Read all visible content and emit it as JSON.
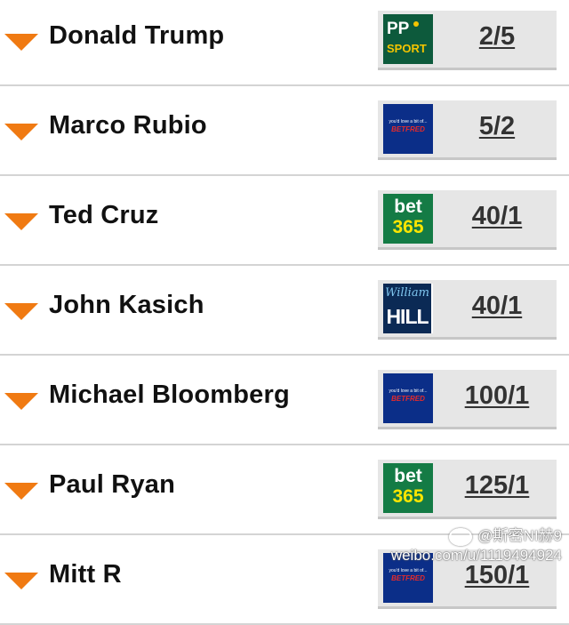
{
  "rows": [
    {
      "name": "Donald Trump",
      "bookmaker": "PP SPORT",
      "logo": "pp",
      "odds": "2/5"
    },
    {
      "name": "Marco Rubio",
      "bookmaker": "BETFRED",
      "logo": "betfred",
      "odds": "5/2"
    },
    {
      "name": "Ted Cruz",
      "bookmaker": "bet 365",
      "logo": "bet365",
      "odds": "40/1"
    },
    {
      "name": "John Kasich",
      "bookmaker": "William HILL",
      "logo": "wh",
      "odds": "40/1"
    },
    {
      "name": "Michael Bloomberg",
      "bookmaker": "BETFRED",
      "logo": "betfred",
      "odds": "100/1"
    },
    {
      "name": "Paul Ryan",
      "bookmaker": "bet 365",
      "logo": "bet365",
      "odds": "125/1"
    },
    {
      "name": "Mitt R",
      "bookmaker": "BETFRED",
      "logo": "betfred",
      "odds": "150/1"
    }
  ],
  "logo_text": {
    "pp_top": "PP",
    "pp_bottom": "SPORT",
    "betfred_small": "you'd love a bit of...",
    "betfred_main": "BETFRED",
    "bet365_top": "bet",
    "bet365_bottom": "365",
    "wh_top": "William",
    "wh_bottom": "HILL"
  },
  "watermark": {
    "handle": "@斯密NI赫9",
    "url": "weibo.com/u/1119494924"
  },
  "colors": {
    "caret": "#f07a12",
    "odds_box": "#e6e6e6",
    "divider": "#d4d4d4"
  },
  "icons": {
    "row_toggle": "chevron-down-icon",
    "watermark": "weibo-icon"
  }
}
